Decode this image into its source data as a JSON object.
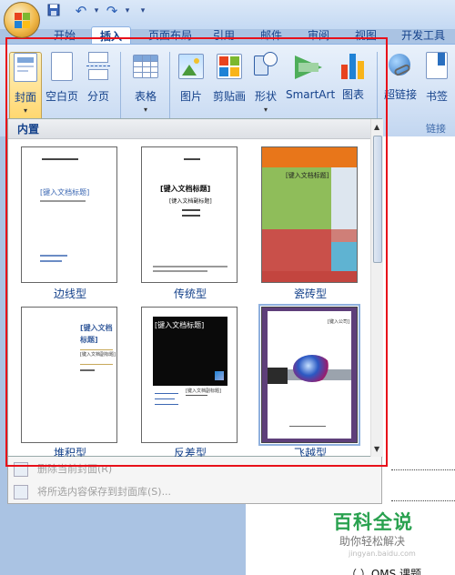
{
  "qat": {
    "undo": "↶",
    "redo": "↷",
    "more": "▾"
  },
  "tabs": [
    "开始",
    "插入",
    "页面布局",
    "引用",
    "邮件",
    "审阅",
    "视图",
    "开发工具"
  ],
  "ribbon": {
    "buttons": [
      "封面",
      "空白页",
      "分页",
      "表格",
      "图片",
      "剪贴画",
      "形状",
      "SmartArt",
      "图表",
      "超链接",
      "书签"
    ],
    "link_group": "链接"
  },
  "gallery": {
    "header": "内置",
    "items": [
      "边线型",
      "传统型",
      "瓷砖型",
      "堆积型",
      "反差型",
      "飞越型"
    ],
    "thumb_text": {
      "t1_title": "[键入文档标题]",
      "t2_title": "[键入文档标题]",
      "t2_sub": "[键入文档副标题]",
      "t3_title": "[键入文档标题]",
      "t4_title": "[键入文档标题]",
      "t4_sub": "[键入文档副标题]",
      "t5_title": "[键入文档标题]",
      "t5_sub": "[键入文档副标题]",
      "t6_top": "[键入公司]"
    }
  },
  "menu": [
    "删除当前封面(R)",
    "将所选内容保存到封面库(S)..."
  ],
  "watermark": {
    "title": "百科全说",
    "sub": "助你轻松解决",
    "url": "jingyan.baidu.com"
  },
  "doc_text": "（  ）OMS 课题",
  "colors": {
    "red_box": "#e8101a",
    "accent": "#15428b",
    "green": "#29a14f"
  }
}
